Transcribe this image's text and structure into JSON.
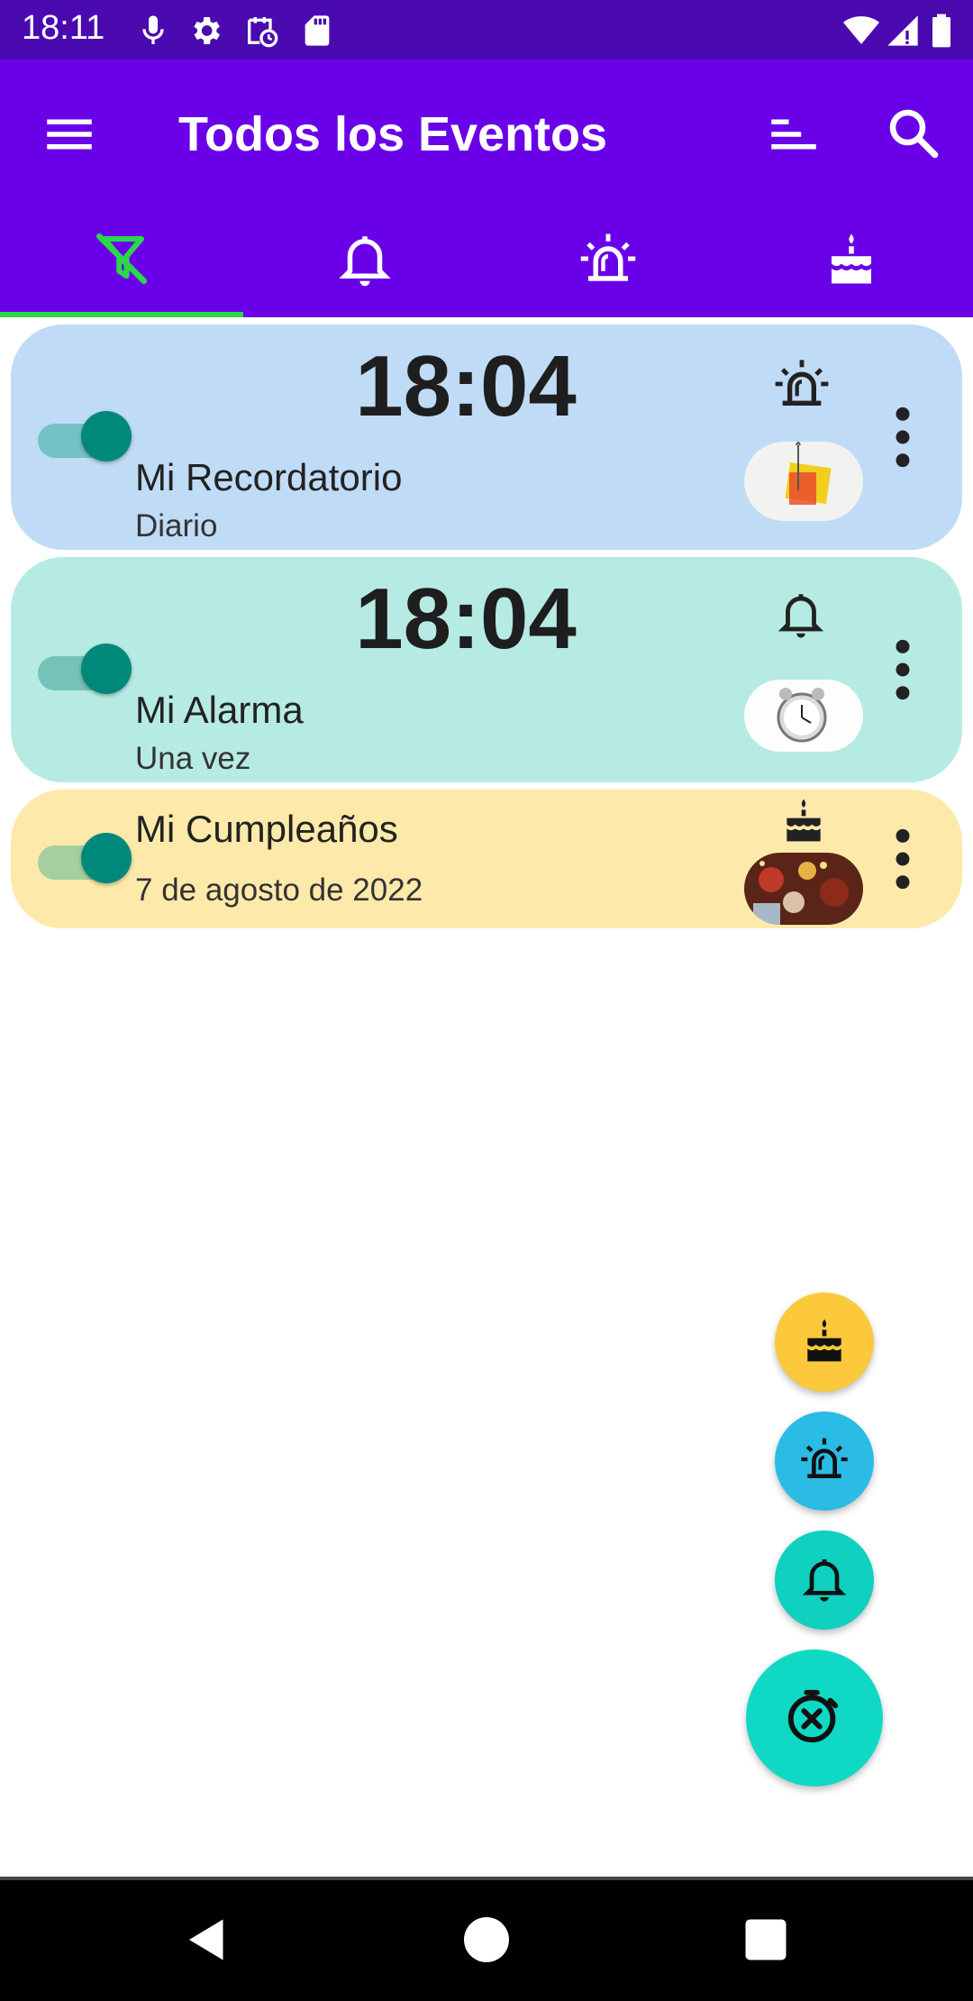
{
  "status_bar": {
    "time": "18:11",
    "left_icons": [
      "mic-icon",
      "settings-icon",
      "calendar-clock-icon",
      "sd-card-icon"
    ],
    "right_icons": [
      "wifi-icon",
      "signal-icon",
      "battery-icon"
    ]
  },
  "app_bar": {
    "title": "Todos los Eventos",
    "menu_icon": "hamburger-menu-icon",
    "sort_icon": "sort-icon",
    "search_icon": "search-icon",
    "background": "#6a00e8"
  },
  "tabs": [
    {
      "icon": "filter-off-icon",
      "selected": true
    },
    {
      "icon": "bell-icon",
      "selected": false
    },
    {
      "icon": "siren-icon",
      "selected": false
    },
    {
      "icon": "cake-icon",
      "selected": false
    }
  ],
  "tab_indicator_color": "#2bd84a",
  "events": [
    {
      "time": "18:04",
      "title": "Mi Recordatorio",
      "subtitle": "Diario",
      "type_icon": "siren-icon",
      "enabled": true,
      "color": "#c0dbf6"
    },
    {
      "time": "18:04",
      "title": "Mi Alarma",
      "subtitle": "Una vez",
      "type_icon": "bell-icon",
      "enabled": true,
      "color": "#b6ebe3"
    },
    {
      "time": "",
      "title": "Mi Cumpleaños",
      "subtitle": "7 de agosto de 2022",
      "type_icon": "cake-icon",
      "enabled": true,
      "color": "#fdeaaa"
    }
  ],
  "fabs": [
    {
      "icon": "cake-icon",
      "color": "#fbc93b"
    },
    {
      "icon": "siren-icon",
      "color": "#2bbce6"
    },
    {
      "icon": "bell-icon",
      "color": "#10d0c0"
    },
    {
      "icon": "timer-off-icon",
      "color": "#0fd9c4"
    }
  ],
  "nav_bar": [
    "back-icon",
    "home-icon",
    "recents-icon"
  ]
}
